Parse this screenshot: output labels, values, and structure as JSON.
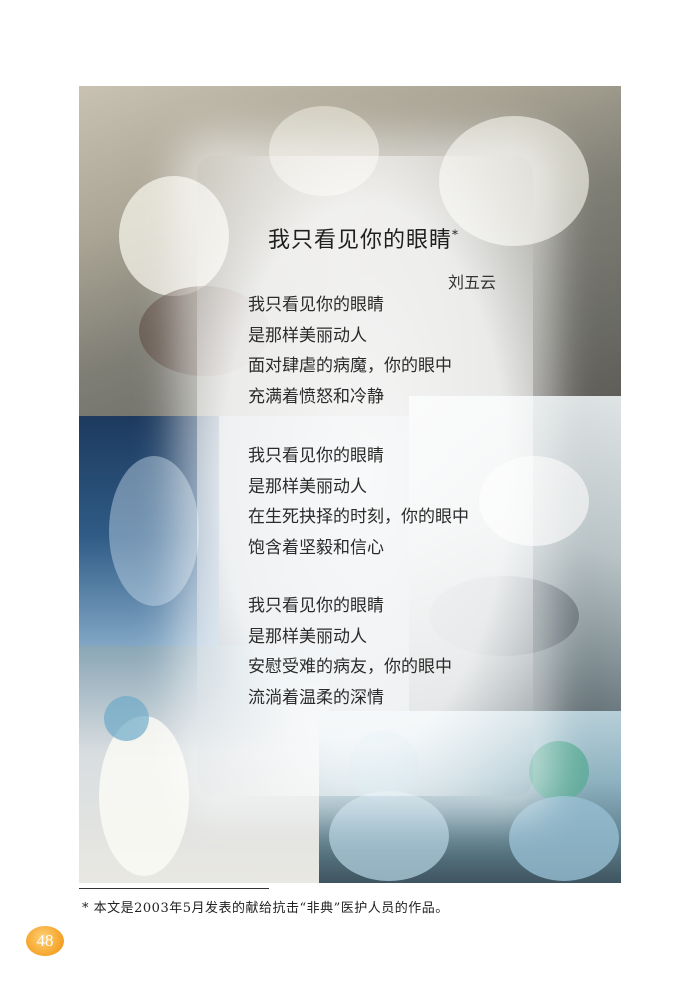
{
  "poem": {
    "title": "我只看见你的眼睛",
    "title_mark": "*",
    "author": "刘五云",
    "stanzas": [
      [
        "我只看见你的眼睛",
        "是那样美丽动人",
        "面对肆虐的病魔，你的眼中",
        "充满着愤怒和冷静"
      ],
      [
        "我只看见你的眼睛",
        "是那样美丽动人",
        "在生死抉择的时刻，你的眼中",
        "饱含着坚毅和信心"
      ],
      [
        "我只看见你的眼睛",
        "是那样美丽动人",
        "安慰受难的病友，你的眼中",
        "流淌着温柔的深情"
      ]
    ]
  },
  "footnote": "* 本文是2003年5月发表的献给抗击“非典”医护人员的作品。",
  "page_number": "48",
  "colors": {
    "badge": "#f6a830",
    "text": "#2b2b2b"
  }
}
